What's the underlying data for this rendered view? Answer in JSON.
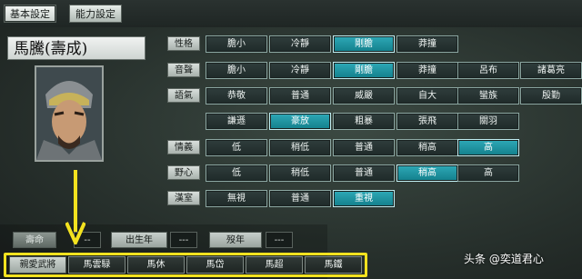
{
  "tabs": [
    {
      "label": "基本設定",
      "active": true
    },
    {
      "label": "能力設定",
      "active": false
    }
  ],
  "character": {
    "name": "馬騰(壽成)"
  },
  "attribute_rows": [
    {
      "label": "性格",
      "options": [
        {
          "text": "膽小"
        },
        {
          "text": "冷靜"
        },
        {
          "text": "剛膽",
          "selected": true
        },
        {
          "text": "莽撞"
        }
      ]
    },
    {
      "label": "音聲",
      "options": [
        {
          "text": "膽小"
        },
        {
          "text": "冷靜"
        },
        {
          "text": "剛膽",
          "selected": true
        },
        {
          "text": "莽撞"
        },
        {
          "text": "呂布"
        },
        {
          "text": "諸葛亮"
        }
      ]
    },
    {
      "label": "語氣",
      "options": [
        {
          "text": "恭敬"
        },
        {
          "text": "普通"
        },
        {
          "text": "威嚴"
        },
        {
          "text": "自大"
        },
        {
          "text": "蠻族"
        },
        {
          "text": "殷勤"
        }
      ]
    },
    {
      "label": "",
      "options": [
        {
          "text": "謙遜"
        },
        {
          "text": "豪放",
          "selected": true
        },
        {
          "text": "粗暴"
        },
        {
          "text": "張飛"
        },
        {
          "text": "關羽"
        }
      ]
    },
    {
      "label": "情義",
      "options": [
        {
          "text": "低"
        },
        {
          "text": "稍低"
        },
        {
          "text": "普通"
        },
        {
          "text": "稍高"
        },
        {
          "text": "高",
          "selected": true
        }
      ]
    },
    {
      "label": "野心",
      "options": [
        {
          "text": "低"
        },
        {
          "text": "稍低"
        },
        {
          "text": "普通"
        },
        {
          "text": "稍高",
          "selected": true
        },
        {
          "text": "高"
        }
      ]
    },
    {
      "label": "漢室",
      "options": [
        {
          "text": "無視"
        },
        {
          "text": "普通"
        },
        {
          "text": "重視",
          "selected": true
        }
      ]
    }
  ],
  "info": {
    "lifespan_label": "壽命",
    "lifespan_value": "--",
    "birth_label": "出生年",
    "birth_value": "---",
    "death_label": "歿年",
    "death_value": "---"
  },
  "relations": [
    {
      "text": "親愛武將"
    },
    {
      "text": "馬雲騄"
    },
    {
      "text": "馬休"
    },
    {
      "text": "馬岱"
    },
    {
      "text": "馬超"
    },
    {
      "text": "馬鐵"
    }
  ],
  "watermark": "头条 @奕道君心",
  "colors": {
    "selected": "#1e96a4",
    "highlight": "#f3e21f"
  }
}
